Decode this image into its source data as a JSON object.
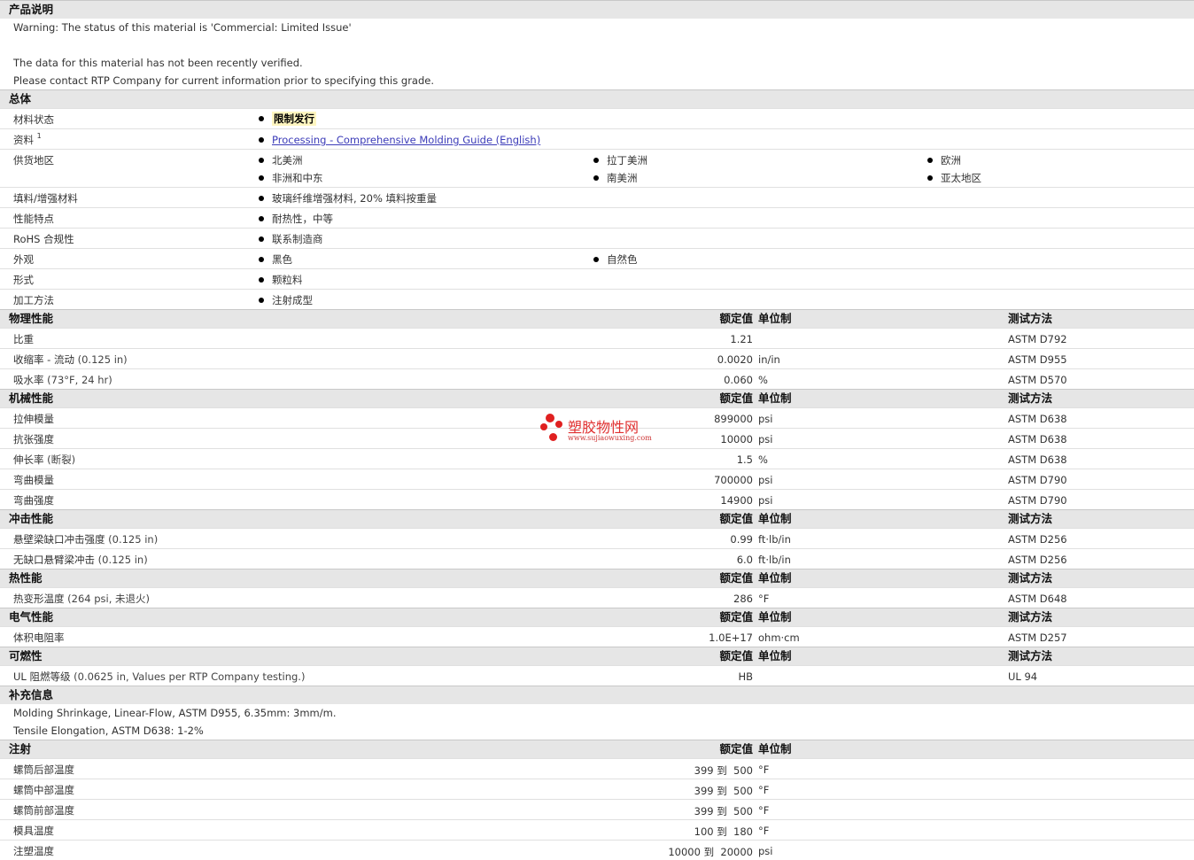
{
  "description": {
    "title": "产品说明",
    "lines": [
      "Warning: The status of this material is 'Commercial: Limited Issue'",
      "",
      "The data for this material has not been recently verified.",
      "Please contact RTP Company for current information prior to specifying this grade."
    ]
  },
  "general": {
    "title": "总体",
    "status_label": "材料状态",
    "status_value": "限制发行",
    "docs_label": "资料",
    "docs_sup": "1",
    "docs_link": "Processing - Comprehensive Molding Guide (English)",
    "region_label": "供货地区",
    "regions": [
      "北美洲",
      "拉丁美洲",
      "欧洲",
      "非洲和中东",
      "南美洲",
      "亚太地区"
    ],
    "filler_label": "填料/增强材料",
    "filler_value": "玻璃纤维增强材料, 20% 填料按重量",
    "features_label": "性能特点",
    "features_value": "耐热性，中等",
    "rohs_label": "RoHS 合规性",
    "rohs_value": "联系制造商",
    "appearance_label": "外观",
    "appearance_values": [
      "黑色",
      "自然色"
    ],
    "form_label": "形式",
    "form_value": "颗粒料",
    "method_label": "加工方法",
    "method_value": "注射成型"
  },
  "headers": {
    "value": "额定值",
    "unit": "单位制",
    "method": "测试方法"
  },
  "physical": {
    "title": "物理性能",
    "rows": [
      {
        "label": "比重",
        "cond": "",
        "value": "1.21",
        "unit": "",
        "method": "ASTM D792"
      },
      {
        "label": "收缩率 - 流动",
        "cond": "(0.125 in)",
        "value": "0.0020",
        "unit": "in/in",
        "method": "ASTM D955"
      },
      {
        "label": "吸水率",
        "cond": "(73°F, 24 hr)",
        "value": "0.060",
        "unit": "%",
        "method": "ASTM D570"
      }
    ]
  },
  "mechanical": {
    "title": "机械性能",
    "rows": [
      {
        "label": "拉伸模量",
        "cond": "",
        "value": "899000",
        "unit": "psi",
        "method": "ASTM D638"
      },
      {
        "label": "抗张强度",
        "cond": "",
        "value": "10000",
        "unit": "psi",
        "method": "ASTM D638"
      },
      {
        "label": "伸长率",
        "cond": "(断裂)",
        "value": "1.5",
        "unit": "%",
        "method": "ASTM D638"
      },
      {
        "label": "弯曲模量",
        "cond": "",
        "value": "700000",
        "unit": "psi",
        "method": "ASTM D790"
      },
      {
        "label": "弯曲强度",
        "cond": "",
        "value": "14900",
        "unit": "psi",
        "method": "ASTM D790"
      }
    ]
  },
  "impact": {
    "title": "冲击性能",
    "rows": [
      {
        "label": "悬壁梁缺口冲击强度",
        "cond": "(0.125 in)",
        "value": "0.99",
        "unit": "ft·lb/in",
        "method": "ASTM D256"
      },
      {
        "label": "无缺口悬臂梁冲击",
        "cond": "(0.125 in)",
        "value": "6.0",
        "unit": "ft·lb/in",
        "method": "ASTM D256"
      }
    ]
  },
  "thermal": {
    "title": "热性能",
    "rows": [
      {
        "label": "热变形温度",
        "cond": "(264 psi, 未退火)",
        "value": "286",
        "unit": "°F",
        "method": "ASTM D648"
      }
    ]
  },
  "electrical": {
    "title": "电气性能",
    "rows": [
      {
        "label": "体积电阻率",
        "cond": "",
        "value": "1.0E+17",
        "unit": "ohm·cm",
        "method": "ASTM D257"
      }
    ]
  },
  "flammability": {
    "title": "可燃性",
    "rows": [
      {
        "label": "UL 阻燃等级",
        "cond": "(0.0625 in, Values per RTP Company testing.)",
        "value": "HB",
        "unit": "",
        "method": "UL 94"
      }
    ]
  },
  "additional": {
    "title": "补充信息",
    "lines": [
      "Molding Shrinkage, Linear-Flow, ASTM D955, 6.35mm: 3mm/m.",
      "Tensile Elongation, ASTM D638: 1-2%"
    ]
  },
  "injection": {
    "title": "注射",
    "rows": [
      {
        "label": "螺筒后部温度",
        "value": "399 到  500",
        "unit": "°F"
      },
      {
        "label": "螺筒中部温度",
        "value": "399 到  500",
        "unit": "°F"
      },
      {
        "label": "螺筒前部温度",
        "value": "399 到  500",
        "unit": "°F"
      },
      {
        "label": "模具温度",
        "value": "100 到  180",
        "unit": "°F"
      },
      {
        "label": "注塑温度",
        "value": "10000 到  20000",
        "unit": "psi"
      }
    ]
  },
  "watermark": {
    "text": "塑胶物性网",
    "url": "www.sujiaowuxing.com"
  },
  "colors": {
    "section_bg": "#e6e6e6",
    "highlight": "#fff6c0",
    "link": "#3b3bb8",
    "watermark": "#e02020"
  }
}
